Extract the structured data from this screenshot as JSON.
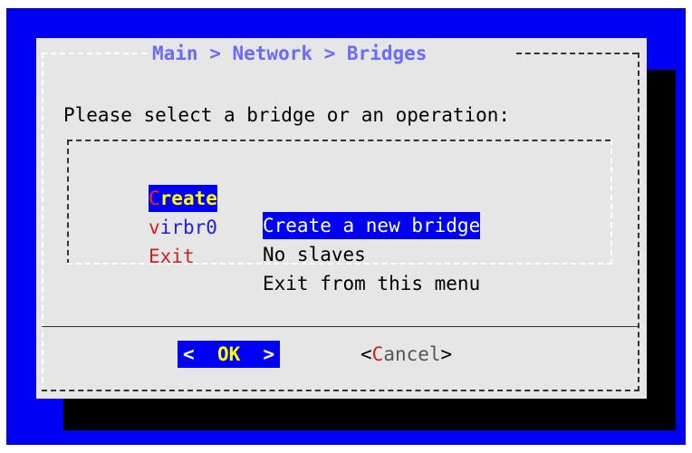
{
  "dialog": {
    "title": "Main > Network > Bridges",
    "prompt": "Please select a bridge or an operation:"
  },
  "menu": {
    "items": [
      {
        "tag_first": "C",
        "tag_rest": "reate",
        "description": "Create a new bridge",
        "selected": true
      },
      {
        "tag_first": "v",
        "tag_rest": "irbr0",
        "description": "No slaves",
        "selected": false
      },
      {
        "tag_first": "E",
        "tag_rest": "xit",
        "description": "Exit from this menu",
        "selected": false
      }
    ]
  },
  "buttons": {
    "ok": {
      "left": "<",
      "label": "OK",
      "right": ">"
    },
    "cancel": {
      "open": "<",
      "hotkey": "C",
      "rest": "ancel",
      "close": ">"
    }
  },
  "colors": {
    "background": "#0000f5",
    "dialog": "#e6e6e6",
    "shadow": "#000000",
    "title": "#6a6aff",
    "hotkey": "#d12020",
    "selected_text": "#ffffff",
    "selected_tag": "#ffff00"
  }
}
